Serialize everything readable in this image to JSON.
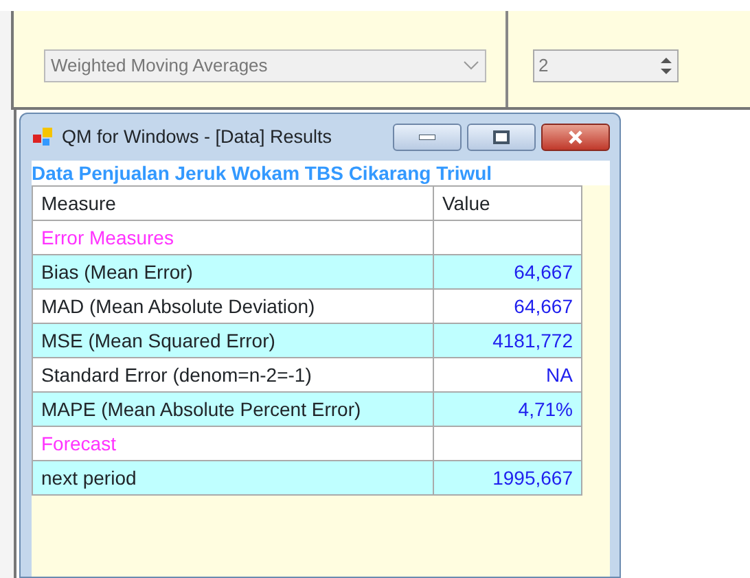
{
  "method_dropdown": {
    "value": "Weighted Moving Averages",
    "disabled": true
  },
  "periods_spinner": {
    "value": "2",
    "disabled": true
  },
  "window": {
    "title": "QM for Windows - [Data] Results"
  },
  "results_title": "Data Penjualan Jeruk Wokam TBS Cikarang Triwul",
  "table": {
    "columns": [
      "Measure",
      "Value"
    ],
    "rows": [
      {
        "kind": "section",
        "measure": "Error Measures",
        "value": "",
        "shaded": false
      },
      {
        "kind": "data",
        "measure": "Bias (Mean Error)",
        "value": "64,667",
        "shaded": true
      },
      {
        "kind": "data",
        "measure": "MAD (Mean Absolute Deviation)",
        "value": "64,667",
        "shaded": false
      },
      {
        "kind": "data",
        "measure": "MSE (Mean Squared Error)",
        "value": "4181,772",
        "shaded": true
      },
      {
        "kind": "data",
        "measure": "Standard Error (denom=n-2=-1)",
        "value": "NA",
        "shaded": false
      },
      {
        "kind": "data",
        "measure": "MAPE (Mean Absolute Percent Error)",
        "value": "4,71%",
        "shaded": true
      },
      {
        "kind": "section",
        "measure": "Forecast",
        "value": "",
        "shaded": false
      },
      {
        "kind": "data",
        "measure": "next period",
        "value": "1995,667",
        "shaded": true
      }
    ]
  }
}
